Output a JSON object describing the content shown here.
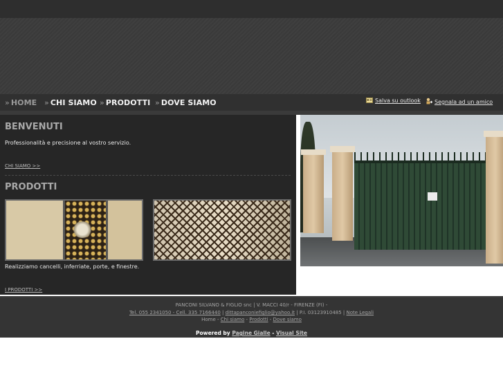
{
  "nav": {
    "items": [
      {
        "label": "HOME",
        "active": true
      },
      {
        "label": "CHI SIAMO"
      },
      {
        "label": "PRODOTTI"
      },
      {
        "label": "DOVE SIAMO"
      }
    ],
    "util": {
      "outlook": "Salva su outlook",
      "friend": "Segnala ad un amico"
    }
  },
  "welcome": {
    "title": "BENVENUTI",
    "text": "Professionalità e precisione al vostro servizio.",
    "link": "CHI SIAMO >>"
  },
  "products": {
    "title": "PRODOTTI",
    "text": "Realizziamo cancelli, inferriate, porte, e finestre.",
    "link": "I PRODOTTI >>"
  },
  "footer": {
    "company": "PANCONI SILVANO & FIGLIO snc | V. MACCI 40/r - FIRENZE (FI) -",
    "phones": "Tel. 055 2341050 - Cell. 335 7166440",
    "sep1": "|",
    "email": "dittapanconiefiglio@yahoo.it",
    "vat": "| P.I. 03123910485 |",
    "legal": "Note Legali",
    "links": [
      "Home",
      "Chi siamo",
      "Prodotti",
      "Dove siamo"
    ],
    "link_sep": "-",
    "powered_by": "Powered by",
    "pagine_gialle": "Pagine Gialle",
    "dash": "-",
    "visual_site": "Visual Site"
  },
  "icons": {
    "nav_bullet": "chevron-double-right-icon",
    "outlook": "contact-card-icon",
    "friend": "person-share-icon"
  },
  "colors": {
    "background": "#262626",
    "accent_text": "#a9a9a9",
    "footer": "#343434"
  }
}
